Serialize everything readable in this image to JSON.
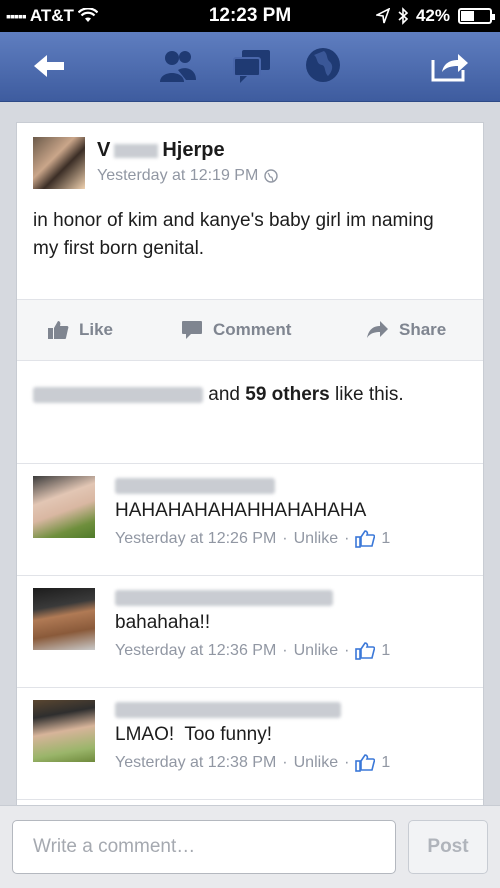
{
  "status_bar": {
    "carrier": "AT&T",
    "time": "12:23 PM",
    "battery": "42%"
  },
  "nav": {
    "icons": [
      "back-arrow-icon",
      "friends-icon",
      "messages-icon",
      "globe-icon",
      "share-icon"
    ]
  },
  "post": {
    "author": "V···· Hjerpe",
    "author_first_initial": "V",
    "author_last": "Hjerpe",
    "timestamp": "Yesterday at 12:19 PM",
    "text": "in honor of kim and kanye's baby girl im naming my first born genital."
  },
  "actions": {
    "like": "Like",
    "comment": "Comment",
    "share": "Share"
  },
  "likes": {
    "middle": "and",
    "count_text": "59 others",
    "suffix": "like this."
  },
  "comments": [
    {
      "text": "HAHAHAHAHAHHAHAHAHA",
      "time": "Yesterday at 12:26 PM",
      "unlike": "Unlike",
      "like_count": "1"
    },
    {
      "text": "bahahaha!!",
      "time": "Yesterday at 12:36 PM",
      "unlike": "Unlike",
      "like_count": "1"
    },
    {
      "text": "LMAO!  Too funny!",
      "time": "Yesterday at 12:38 PM",
      "unlike": "Unlike",
      "like_count": "1"
    }
  ],
  "composer": {
    "placeholder": "Write a comment…",
    "post_label": "Post"
  },
  "colors": {
    "nav_blue": "#4a67ab",
    "link_blue": "#3b5998",
    "meta_gray": "#9197a3"
  }
}
